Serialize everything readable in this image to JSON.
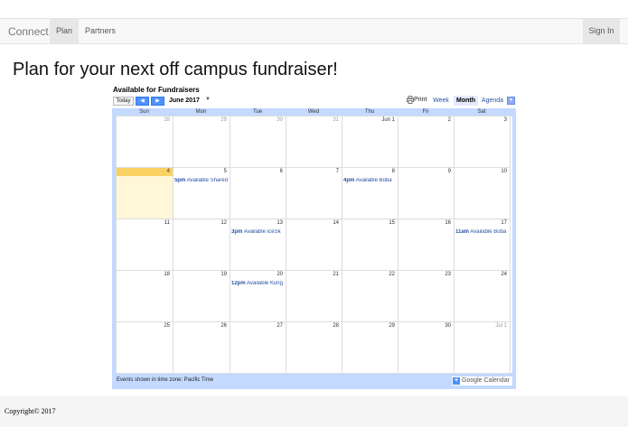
{
  "navbar": {
    "brand": "Connect",
    "items": [
      {
        "label": "Plan",
        "active": true
      },
      {
        "label": "Partners",
        "active": false
      }
    ],
    "signin_label": "Sign In"
  },
  "page": {
    "title": "Plan for your next off campus fundraiser!"
  },
  "calendar": {
    "title": "Available for Fundraisers",
    "today_label": "Today",
    "prev_label": "◀",
    "next_label": "▶",
    "month_label": "June 2017",
    "print_label": "Print",
    "views": {
      "week": "Week",
      "month": "Month",
      "agenda": "Agenda"
    },
    "active_view": "Month",
    "weekdays": [
      "Sun",
      "Mon",
      "Tue",
      "Wed",
      "Thu",
      "Fri",
      "Sat"
    ],
    "weeks": [
      [
        {
          "num": "28",
          "other": true
        },
        {
          "num": "29",
          "other": true
        },
        {
          "num": "30",
          "other": true
        },
        {
          "num": "31",
          "other": true
        },
        {
          "num": "Jun 1"
        },
        {
          "num": "2"
        },
        {
          "num": "3"
        }
      ],
      [
        {
          "num": "4",
          "today": true
        },
        {
          "num": "5",
          "event_time": "5pm",
          "event_title": "Available Shared"
        },
        {
          "num": "6"
        },
        {
          "num": "7"
        },
        {
          "num": "8",
          "event_time": "4pm",
          "event_title": "Available Boba"
        },
        {
          "num": "9"
        },
        {
          "num": "10"
        }
      ],
      [
        {
          "num": "11"
        },
        {
          "num": "12"
        },
        {
          "num": "13",
          "event_time": "3pm",
          "event_title": "Available IceSk"
        },
        {
          "num": "14"
        },
        {
          "num": "15"
        },
        {
          "num": "16"
        },
        {
          "num": "17",
          "event_time": "11am",
          "event_title": "Available Boba"
        }
      ],
      [
        {
          "num": "18"
        },
        {
          "num": "19"
        },
        {
          "num": "20",
          "event_time": "12pm",
          "event_title": "Available Kung"
        },
        {
          "num": "21"
        },
        {
          "num": "22"
        },
        {
          "num": "23"
        },
        {
          "num": "24"
        }
      ],
      [
        {
          "num": "25"
        },
        {
          "num": "26"
        },
        {
          "num": "27"
        },
        {
          "num": "28"
        },
        {
          "num": "29"
        },
        {
          "num": "30"
        },
        {
          "num": "Jul 1",
          "other": true
        }
      ]
    ],
    "timezone_note": "Events shown in time zone: Pacific Time",
    "google_badge": "Google Calendar",
    "colors": {
      "header": "#c3d9ff",
      "today": "#fad163",
      "event": "#2952a3"
    }
  },
  "footer": {
    "text": "Copyright© 2017"
  }
}
